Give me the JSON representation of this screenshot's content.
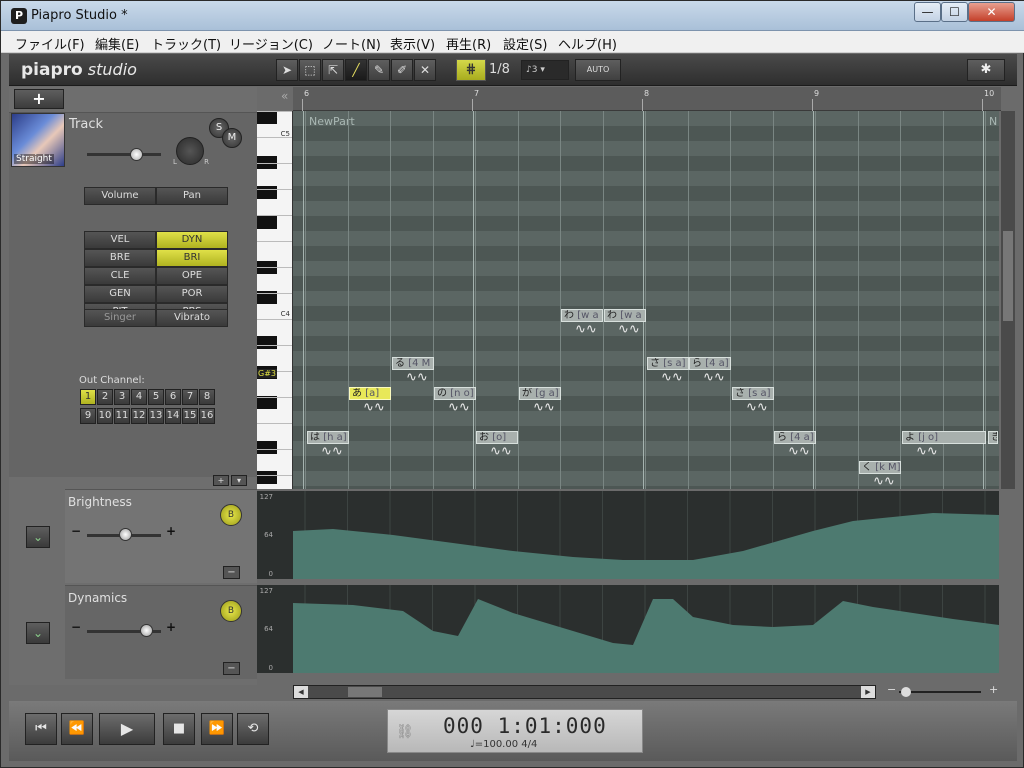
{
  "window": {
    "title": "Piapro Studio *",
    "app_icon": "P",
    "minimize": "—",
    "maximize": "☐",
    "close": "✕"
  },
  "menu": [
    "ファイル(F)",
    "編集(E)",
    "トラック(T)",
    "リージョン(C)",
    "ノート(N)",
    "表示(V)",
    "再生(R)",
    "設定(S)",
    "ヘルプ(H)"
  ],
  "toolbar": {
    "logo_main": "piapro",
    "logo_sub": " studio",
    "tools": [
      {
        "name": "arrow-tool",
        "glyph": "➤"
      },
      {
        "name": "marquee-tool",
        "glyph": "⬚"
      },
      {
        "name": "select-tool",
        "glyph": "⇱"
      },
      {
        "name": "line-tool",
        "glyph": "╱"
      },
      {
        "name": "pencil-tool",
        "glyph": "✎"
      },
      {
        "name": "brush-tool",
        "glyph": "✐"
      },
      {
        "name": "eraser-tool",
        "glyph": "✕"
      }
    ],
    "active_tool": 3,
    "grid_glyph": "⋕",
    "quantize": "1/8",
    "quantize_option": "♪3",
    "auto_label": "AUTO",
    "settings_glyph": "✱"
  },
  "track": {
    "add_label": "+",
    "collapse_glyph": "«",
    "avatar_label": "Straight",
    "name": "Track",
    "solo": "S",
    "mute": "M",
    "pan_l": "L",
    "pan_r": "R",
    "volume_level": 0.78,
    "vol_pan": [
      "Volume",
      "Pan"
    ],
    "params": [
      {
        "left": "VEL",
        "right": "DYN",
        "right_active": true
      },
      {
        "left": "BRE",
        "right": "BRI",
        "right_active": true
      },
      {
        "left": "CLE",
        "right": "OPE",
        "right_active": false
      },
      {
        "left": "GEN",
        "right": "POR",
        "right_active": false
      },
      {
        "left": "PIT",
        "right": "PBS",
        "right_active": false
      }
    ],
    "singer": "Singer",
    "vibrato": "Vibrato",
    "out_channel_label": "Out Channel:",
    "channels": [
      "1",
      "2",
      "3",
      "4",
      "5",
      "6",
      "7",
      "8",
      "9",
      "10",
      "11",
      "12",
      "13",
      "14",
      "15",
      "16"
    ],
    "active_channel": "1",
    "add_btn": "+",
    "down_btn": "▾"
  },
  "curves": [
    {
      "name": "Brightness",
      "btn": "B",
      "minus": "−",
      "plus": "+",
      "collapse": "−",
      "chevron": "⌄",
      "level": 0.52,
      "scale": [
        "127",
        "64",
        "0"
      ]
    },
    {
      "name": "Dynamics",
      "btn": "B",
      "minus": "−",
      "plus": "+",
      "collapse": "−",
      "chevron": "⌄",
      "level": 0.8,
      "scale": [
        "127",
        "64",
        "0"
      ]
    }
  ],
  "roll": {
    "part_name": "NewPart",
    "part_end_mark": "N",
    "bars": [
      "6",
      "7",
      "8",
      "9",
      "10"
    ],
    "key_labels": {
      "c5": "C5",
      "c4": "C4",
      "highlight": "G#3"
    }
  },
  "notes": [
    {
      "lyric": "は",
      "phoneme": "[h a]",
      "selected": false
    },
    {
      "lyric": "あ",
      "phoneme": "[a]",
      "selected": true
    },
    {
      "lyric": "る",
      "phoneme": "[4 M",
      "selected": false
    },
    {
      "lyric": "の",
      "phoneme": "[n o]",
      "selected": false
    },
    {
      "lyric": "お",
      "phoneme": "[o]",
      "selected": false
    },
    {
      "lyric": "が",
      "phoneme": "[g a]",
      "selected": false
    },
    {
      "lyric": "わ",
      "phoneme": "[w a",
      "selected": false
    },
    {
      "lyric": "わ",
      "phoneme": "[w a",
      "selected": false
    },
    {
      "lyric": "さ",
      "phoneme": "[s a]",
      "selected": false
    },
    {
      "lyric": "ら",
      "phoneme": "[4 a]",
      "selected": false
    },
    {
      "lyric": "さ",
      "phoneme": "[s a]",
      "selected": false
    },
    {
      "lyric": "ら",
      "phoneme": "[4 a]",
      "selected": false
    },
    {
      "lyric": "く",
      "phoneme": "[k M]",
      "selected": false
    },
    {
      "lyric": "よ",
      "phoneme": "[j o]",
      "selected": false
    },
    {
      "lyric": "き",
      "phoneme": "",
      "selected": false
    }
  ],
  "vibrato_glyph": "∿∿",
  "scroll": {
    "left": "◀",
    "right": "▶",
    "up": "▲",
    "down": "▼",
    "zoom_minus": "−",
    "zoom_plus": "+"
  },
  "transport": {
    "to_start": "⏮",
    "rewind": "⏪",
    "play": "▶",
    "stop": "■",
    "forward": "⏩",
    "loop": "⟲",
    "time": "000 1:01:000",
    "tempo": "♩=100.00  4/4",
    "link_icon": "⛓"
  },
  "colors": {
    "accent": "#dfe048",
    "roll_bg": "#5b6663",
    "curve_fill": "#4d7a70"
  }
}
